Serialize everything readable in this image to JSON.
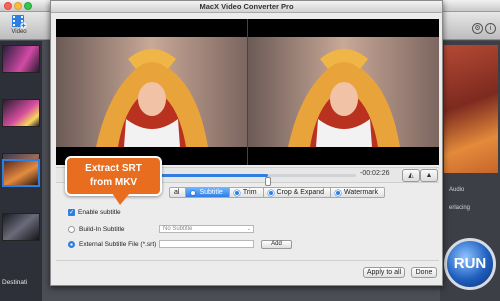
{
  "app": {
    "title": "MacX Video Converter Pro",
    "toolbar_video_label": "Video",
    "destination_label": "Destinati",
    "run_label": "RUN",
    "right_labels": [
      "Audio",
      "erlacing"
    ]
  },
  "dialog": {
    "time": "-00:02:26",
    "tabs": [
      {
        "label": "al",
        "active": false
      },
      {
        "label": "Subtitle",
        "active": true
      },
      {
        "label": "Trim",
        "active": false
      },
      {
        "label": "Crop & Expand",
        "active": false
      },
      {
        "label": "Watermark",
        "active": false
      }
    ],
    "enable_subtitle": "Enable subtitle",
    "enable_subtitle_checked": true,
    "builtin_label": "Build-In Subtitle",
    "builtin_value": "No Subtitle",
    "external_label": "External Subtitle File (*.srt)",
    "external_value": "",
    "add_label": "Add",
    "apply_all_label": "Apply to all",
    "done_label": "Done",
    "playback_fraction": 0.6
  },
  "callout": {
    "line1": "Extract SRT",
    "line2": "from MKV"
  },
  "colors": {
    "accent": "#2f7fe0",
    "callout": "#e86d1f"
  }
}
